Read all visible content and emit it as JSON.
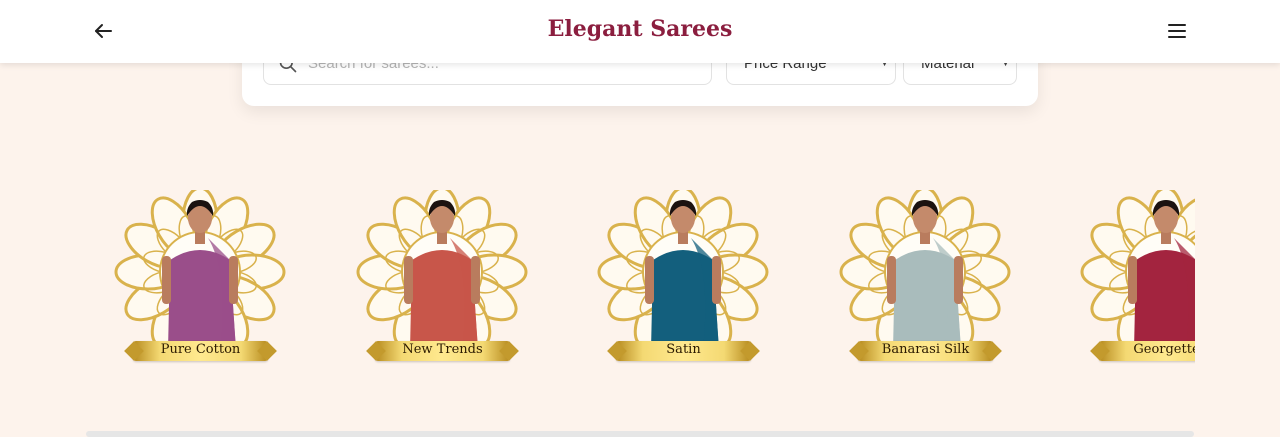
{
  "header": {
    "title": "Elegant Sarees",
    "back_icon": "arrow-left-icon",
    "menu_icon": "hamburger-menu-icon"
  },
  "filters": {
    "search_placeholder": "Search for sarees...",
    "search_icon": "search-icon",
    "price_range_label": "Price Range",
    "material_label": "Material"
  },
  "categories": [
    {
      "label": "Pure Cotton",
      "saree_color": "#9a4e8a"
    },
    {
      "label": "New Trends",
      "saree_color": "#c8564a"
    },
    {
      "label": "Satin",
      "saree_color": "#135f7d"
    },
    {
      "label": "Banarasi Silk",
      "saree_color": "#a9bcbc"
    },
    {
      "label": "Georgette",
      "saree_color": "#a3243f"
    }
  ],
  "colors": {
    "brand": "#8b1e3f",
    "background": "#fdf3ec",
    "gold": "#d9b24c"
  }
}
